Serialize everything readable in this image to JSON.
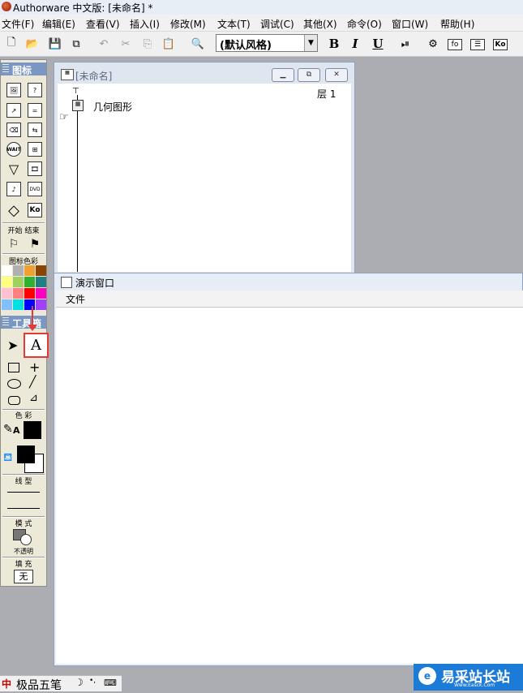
{
  "app": {
    "title": "Authorware 中文版: [未命名] *"
  },
  "menu": [
    "文件(F)",
    "编辑(E)",
    "查看(V)",
    "插入(I)",
    "修改(M)",
    "文本(T)",
    "调试(C)",
    "其他(X)",
    "命令(O)",
    "窗口(W)",
    "帮助(H)"
  ],
  "toolbar": {
    "style_value": "(默认风格)",
    "bold": "B",
    "italic": "I",
    "underline": "U",
    "ko": "Ko"
  },
  "icon_palette": {
    "title": "图标",
    "start_end": [
      "开始",
      "结束"
    ],
    "color_title": "图标色彩",
    "colors": [
      "#ffffff",
      "#b0b0b0",
      "#f0a030",
      "#884400",
      "#ffff80",
      "#a0d060",
      "#30b030",
      "#208080",
      "#ffc0d0",
      "#ff8080",
      "#ff0000",
      "#ff00c0",
      "#80c0ff",
      "#00e0e0",
      "#0000ff",
      "#a040ff"
    ]
  },
  "tool_palette": {
    "title": "工具箱",
    "text_tool": "A",
    "color_label": "色 彩",
    "line_label": "线 型",
    "mode_label": "模 式",
    "mode_value": "不透明",
    "fill_label": "填 充",
    "fill_value": "无"
  },
  "flow_window": {
    "title": "[未命名]",
    "level": "层 1",
    "item_label": "几何图形"
  },
  "present_window": {
    "title": "演示窗口",
    "menu_file": "文件"
  },
  "ime": {
    "label": "极品五笔"
  },
  "brand": {
    "name": "易采站长站",
    "url": "Www.Easck.Com"
  },
  "annotation": {
    "highlight_color": "#e53935"
  }
}
